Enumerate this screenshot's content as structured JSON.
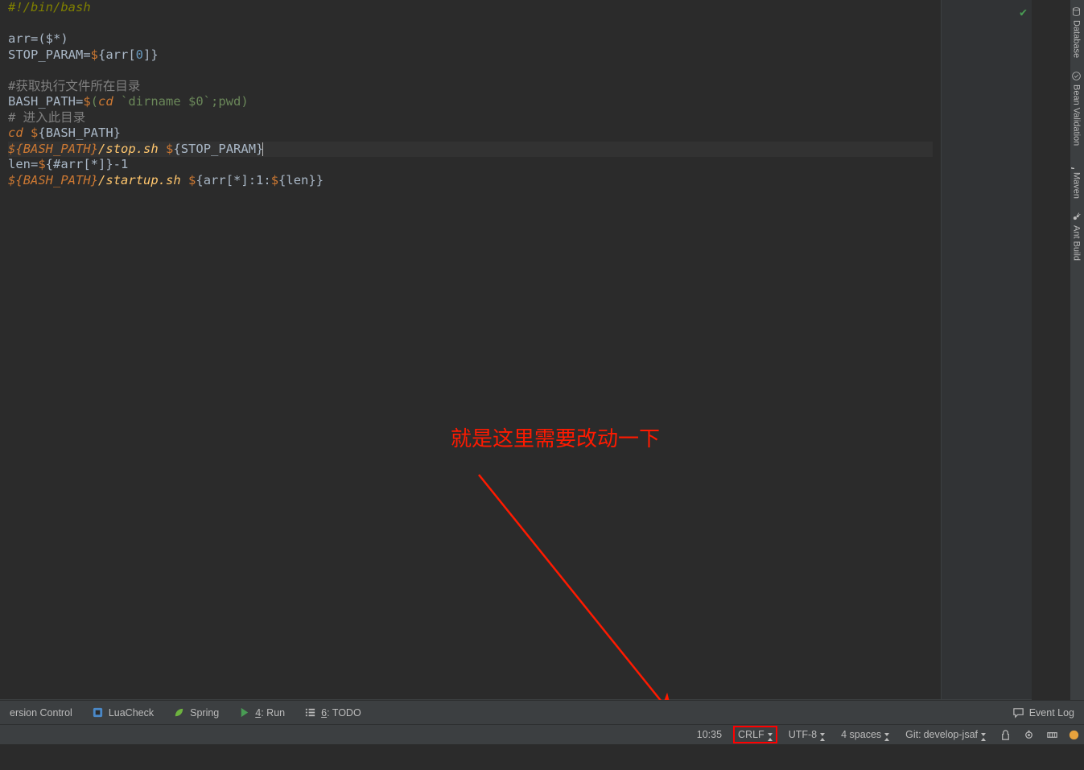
{
  "code": {
    "tokens": [
      [
        {
          "t": "#!/bin/bash",
          "c": "c-olive"
        }
      ],
      [],
      [
        {
          "t": "arr=(",
          "c": "c-def"
        },
        {
          "t": "$",
          "c": "c-def"
        },
        {
          "t": "*)",
          "c": "c-def"
        }
      ],
      [
        {
          "t": "STOP_PARAM=",
          "c": "c-def"
        },
        {
          "t": "$",
          "c": "c-orange-n"
        },
        {
          "t": "{",
          "c": "c-def"
        },
        {
          "t": "arr[",
          "c": "c-def"
        },
        {
          "t": "0",
          "c": "c-blue"
        },
        {
          "t": "]}",
          "c": "c-def"
        }
      ],
      [],
      [
        {
          "t": "#获取执行文件所在目录",
          "c": "c-gray"
        }
      ],
      [
        {
          "t": "BASH_PATH=",
          "c": "c-def"
        },
        {
          "t": "$",
          "c": "c-orange-n"
        },
        {
          "t": "(",
          "c": "c-green"
        },
        {
          "t": "cd ",
          "c": "c-orange"
        },
        {
          "t": "`dirname $0`",
          "c": "c-green"
        },
        {
          "t": ";",
          "c": "c-green"
        },
        {
          "t": "pwd",
          "c": "c-green"
        },
        {
          "t": ")",
          "c": "c-green"
        }
      ],
      [
        {
          "t": "# 进入此目录",
          "c": "c-gray"
        }
      ],
      [
        {
          "t": "cd ",
          "c": "c-orange"
        },
        {
          "t": "$",
          "c": "c-orange-n"
        },
        {
          "t": "{",
          "c": "c-def"
        },
        {
          "t": "BASH_PATH}",
          "c": "c-def"
        }
      ],
      [
        {
          "t": "$",
          "c": "c-orange"
        },
        {
          "t": "{",
          "c": "c-orange"
        },
        {
          "t": "BASH_PATH",
          "c": "c-orange"
        },
        {
          "t": "}",
          "c": "c-orange"
        },
        {
          "t": "/stop.sh ",
          "c": "c-yellow"
        },
        {
          "t": "$",
          "c": "c-orange-n"
        },
        {
          "t": "{",
          "c": "c-def"
        },
        {
          "t": "STOP_PARAM",
          "c": "c-def"
        },
        {
          "t": "}",
          "c": "c-def"
        }
      ],
      [
        {
          "t": "len=",
          "c": "c-def"
        },
        {
          "t": "$",
          "c": "c-orange-n"
        },
        {
          "t": "{",
          "c": "c-def"
        },
        {
          "t": "#arr[*]}-1",
          "c": "c-def"
        }
      ],
      [
        {
          "t": "$",
          "c": "c-orange"
        },
        {
          "t": "{",
          "c": "c-orange"
        },
        {
          "t": "BASH_PATH",
          "c": "c-orange"
        },
        {
          "t": "}",
          "c": "c-orange"
        },
        {
          "t": "/startup.sh ",
          "c": "c-yellow"
        },
        {
          "t": "$",
          "c": "c-orange-n"
        },
        {
          "t": "{",
          "c": "c-def"
        },
        {
          "t": "arr[*]:1:",
          "c": "c-def"
        },
        {
          "t": "$",
          "c": "c-orange-n"
        },
        {
          "t": "{",
          "c": "c-def"
        },
        {
          "t": "len}}",
          "c": "c-def"
        }
      ]
    ],
    "highlighted_line_index": 9
  },
  "right_tools": [
    {
      "name": "database-tool",
      "label": "Database"
    },
    {
      "name": "bean-validation-tool",
      "label": "Bean Validation"
    },
    {
      "name": "maven-tool",
      "label": "Maven"
    },
    {
      "name": "ant-build-tool",
      "label": "Ant Build"
    }
  ],
  "bottom_bar": {
    "items": [
      {
        "name": "version-control-btn",
        "label": "ersion Control"
      },
      {
        "name": "luacheck-btn",
        "label": "LuaCheck"
      },
      {
        "name": "spring-btn",
        "label": "Spring"
      },
      {
        "name": "run-btn",
        "prefix": "4",
        "label": ": Run"
      },
      {
        "name": "todo-btn",
        "prefix": "6",
        "label": ": TODO"
      }
    ],
    "event_log": "Event Log"
  },
  "status": {
    "caret": "10:35",
    "line_sep": "CRLF",
    "encoding": "UTF-8",
    "indent": "4 spaces",
    "git_prefix": "Git: ",
    "git_branch": "develop-jsaf"
  },
  "annotation": {
    "text": "就是这里需要改动一下"
  }
}
